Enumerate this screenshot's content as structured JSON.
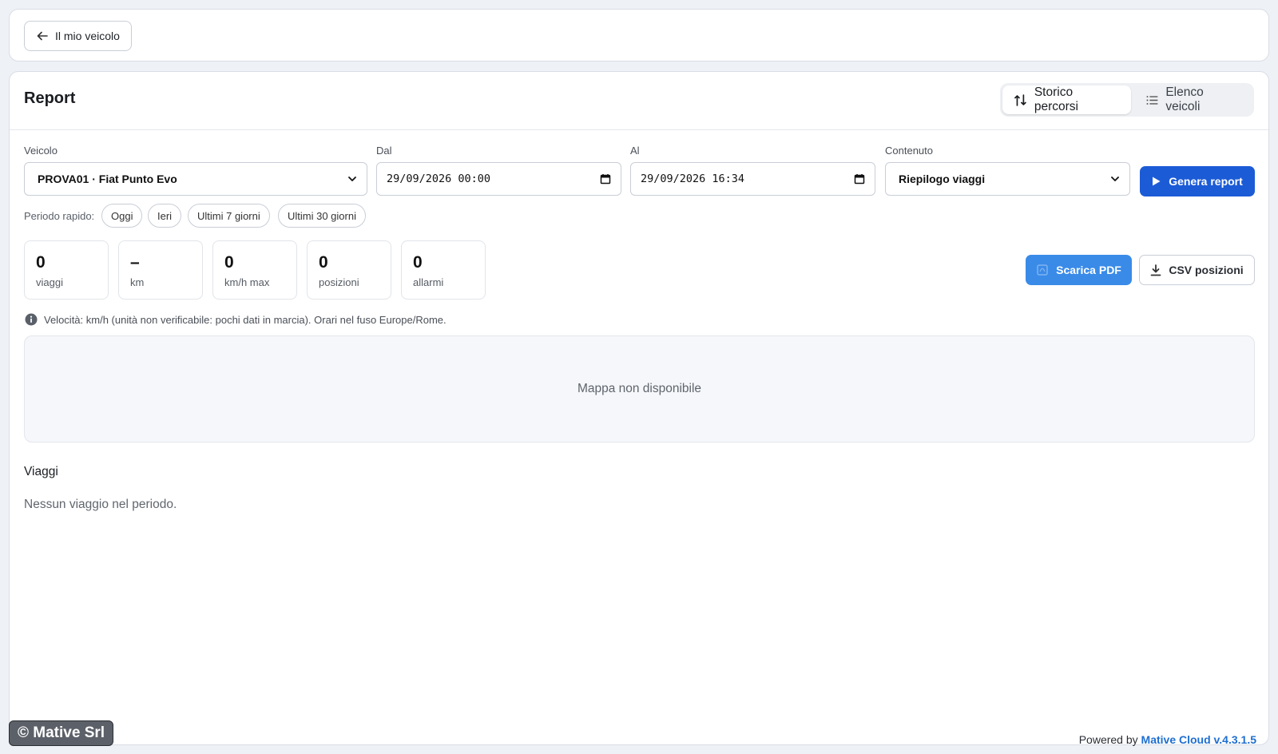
{
  "top_bar": {
    "back_label": "Il mio veicolo"
  },
  "header": {
    "title": "Report",
    "tabs": [
      {
        "label": "Storico percorsi",
        "icon": "route-icon",
        "active": true
      },
      {
        "label": "Elenco veicoli",
        "icon": "list-icon",
        "active": false
      }
    ]
  },
  "form": {
    "vehicle": {
      "label": "Veicolo",
      "value": "PROVA01 · Fiat Punto Evo"
    },
    "from": {
      "label": "Dal",
      "value": "29/09/2026 00:00"
    },
    "to": {
      "label": "Al",
      "value": "29/09/2026 16:34"
    },
    "content": {
      "label": "Contenuto",
      "value": "Riepilogo viaggi"
    },
    "generate_label": "Genera report"
  },
  "quick_period": {
    "label": "Periodo rapido:",
    "options": [
      "Oggi",
      "Ieri",
      "Ultimi 7 giorni",
      "Ultimi 30 giorni"
    ]
  },
  "stats": [
    {
      "value": "0",
      "label": "viaggi"
    },
    {
      "value": "–",
      "label": "km"
    },
    {
      "value": "0",
      "label": "km/h max"
    },
    {
      "value": "0",
      "label": "posizioni"
    },
    {
      "value": "0",
      "label": "allarmi"
    }
  ],
  "actions": {
    "pdf_label": "Scarica PDF",
    "csv_label": "CSV posizioni"
  },
  "info_text": "Velocità: km/h (unità non verificabile: pochi dati in marcia). Orari nel fuso Europe/Rome.",
  "map_message": "Mappa non disponibile",
  "trips": {
    "title": "Viaggi",
    "empty_message": "Nessun viaggio nel periodo."
  },
  "footer": {
    "watermark": "© Mative Srl",
    "powered_prefix": "Powered by",
    "powered_brand": "Mative Cloud v.4.3.1.5"
  },
  "colors": {
    "primary": "#1c5bd6",
    "pdf_button": "#3a8be8",
    "brand_link": "#1f6fd1",
    "page_bg": "#eef1f6"
  }
}
